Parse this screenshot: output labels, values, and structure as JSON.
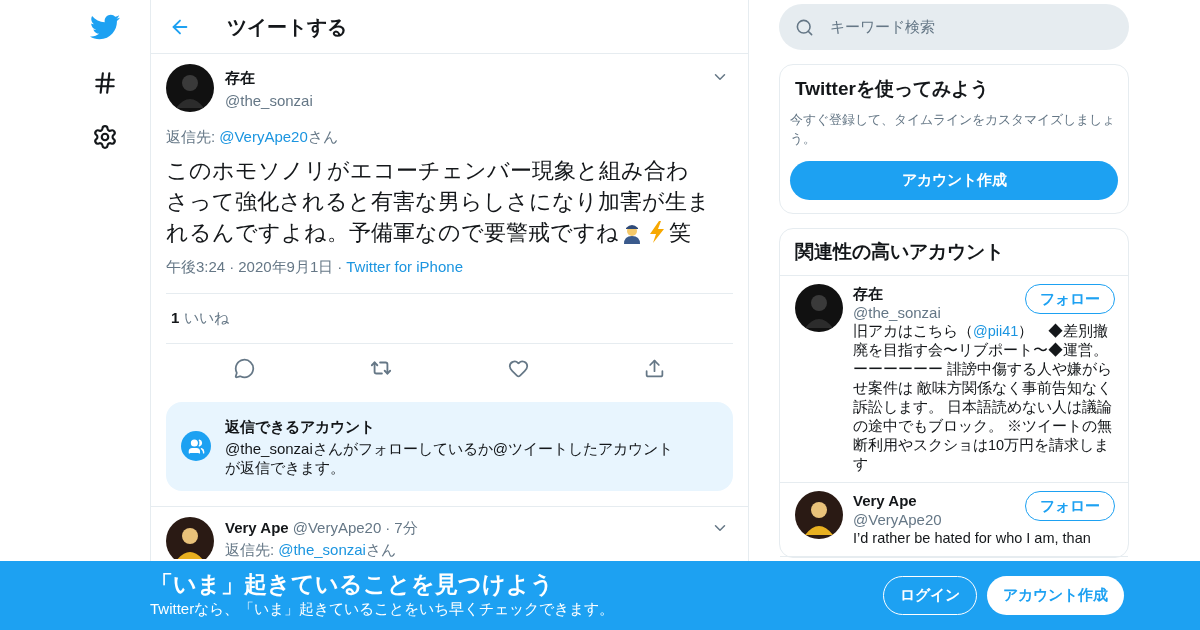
{
  "header": {
    "title": "ツイートする"
  },
  "tweet": {
    "name": "存在",
    "handle": "@the_sonzai",
    "reply_label": "返信先: ",
    "reply_to": "@VeryApe20",
    "reply_suffix": "さん",
    "body_lines": [
      "このホモソノリがエコーチェンバー現象と組み合わ",
      "さって強化されると有害な男らしさになり加害が生ま",
      "れるんですよね。予備軍なので要警戒ですね"
    ],
    "body_end": "笑",
    "time": "午後3:24",
    "separators": [
      "·",
      "·"
    ],
    "date": "2020年9月1日",
    "source": "Twitter for iPhone",
    "likes_count": "1",
    "likes_label": "いいね"
  },
  "reply_notice": {
    "title": "返信できるアカウント",
    "text": "@the_sonzaiさんがフォローしているか@ツイートしたアカウントが返信できます。"
  },
  "replies": [
    {
      "name": "Very Ape",
      "handle": "@VeryApe20",
      "separator": "·",
      "time": "7分",
      "reply_label": "返信先: ",
      "reply_to": "@the_sonzai",
      "reply_suffix": "さん"
    }
  ],
  "search": {
    "placeholder": "キーワード検索"
  },
  "signup_card": {
    "title": "Twitterを使ってみよう",
    "text": "今すぐ登録して、タイムラインをカスタマイズしましょう。",
    "button": "アカウント作成"
  },
  "related": {
    "title": "関連性の高いアカウント",
    "accounts": [
      {
        "name": "存在",
        "handle": "@the_sonzai",
        "follow": "フォロー",
        "bio": [
          {
            "kind": "text",
            "text": "旧アカはこちら（"
          },
          {
            "kind": "link",
            "text": "@pii41"
          },
          {
            "kind": "text",
            "text": "）　◆差別撤廃を目指す会〜リブポート〜◆運営。ーーーーーー 誹謗中傷する人や嫌がらせ案件は 敵味方関係なく事前告知なく訴訟します。 日本語読めない人は議論の途中でもブロック。 ※ツイートの無断利用やスクショは10万円を請求します"
          }
        ]
      },
      {
        "name": "Very Ape",
        "handle": "@VeryApe20",
        "follow": "フォロー",
        "bio": [
          {
            "kind": "text",
            "text": "I’d rather be hated for who I am, than"
          }
        ]
      }
    ]
  },
  "banner": {
    "title": "「いま」起きていることを見つけよう",
    "text": "Twitterなら、「いま」起きていることをいち早くチェックできます。",
    "buttons": [
      {
        "label": "ログイン",
        "kind": "outline"
      },
      {
        "label": "アカウント作成",
        "kind": "filled"
      }
    ]
  }
}
